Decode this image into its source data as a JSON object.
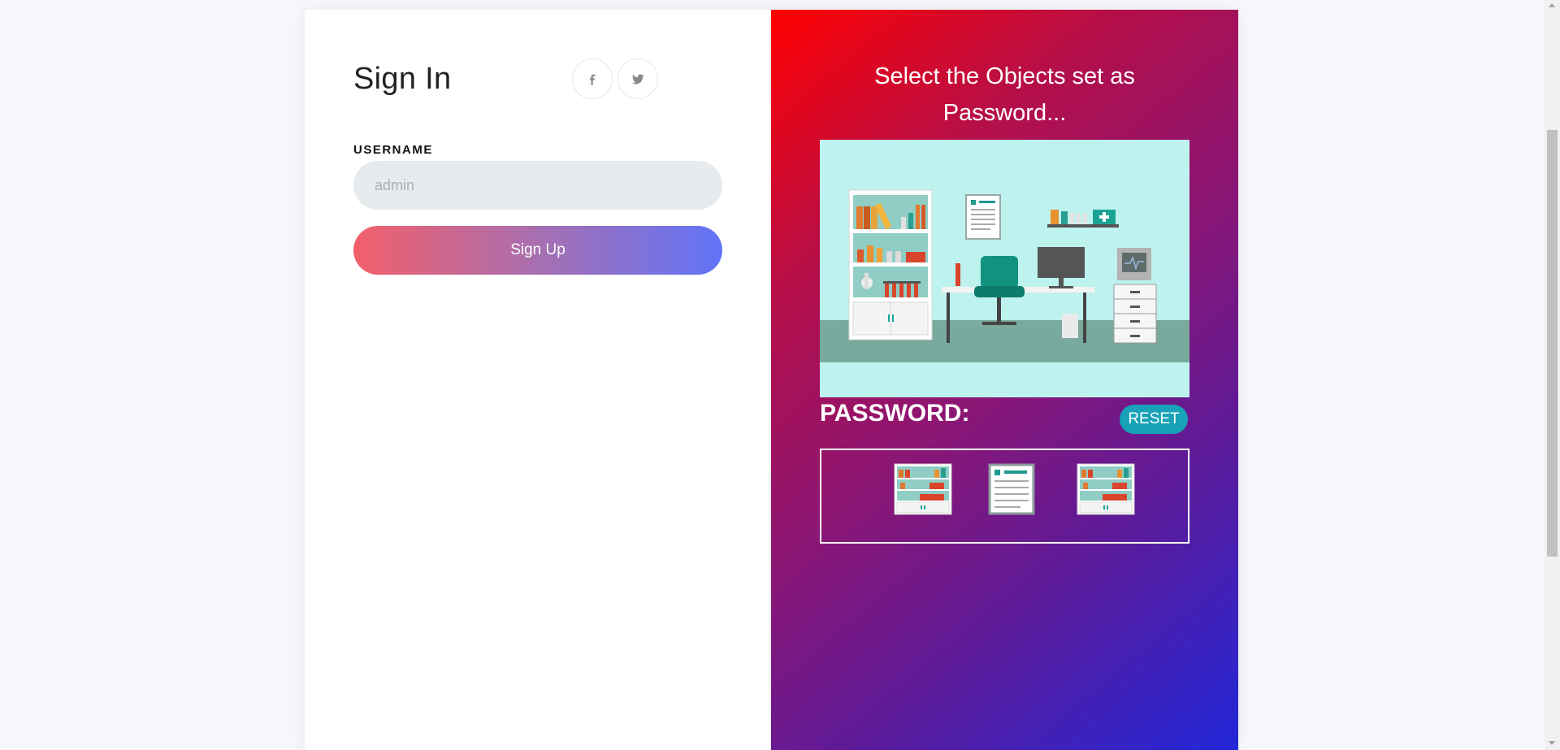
{
  "signin": {
    "title": "Sign In",
    "social": [
      {
        "icon": "facebook-icon",
        "glyph": "f"
      },
      {
        "icon": "twitter-icon"
      }
    ],
    "username": {
      "label": "USERNAME",
      "value": "",
      "placeholder": "admin"
    },
    "submit_label": "Sign Up"
  },
  "password_panel": {
    "heading_line1": "Select the Objects set as",
    "heading_line2": "Password...",
    "scene_icon": "clinic-office-illustration",
    "password_label": "PASSWORD:",
    "reset_label": "RESET",
    "selected": [
      {
        "icon": "bookshelf-icon"
      },
      {
        "icon": "clipboard-chart-icon"
      },
      {
        "icon": "bookshelf-icon"
      }
    ]
  },
  "colors": {
    "panel_gradient": [
      "#ff0000",
      "#b50f49",
      "#8a1675",
      "#5c1b9a",
      "#2227d9"
    ],
    "button_gradient": [
      "#f35f6a",
      "#a76fb1",
      "#6074f8"
    ],
    "reset": "#17a2b8",
    "scene_wall": "#bdf2ee"
  }
}
